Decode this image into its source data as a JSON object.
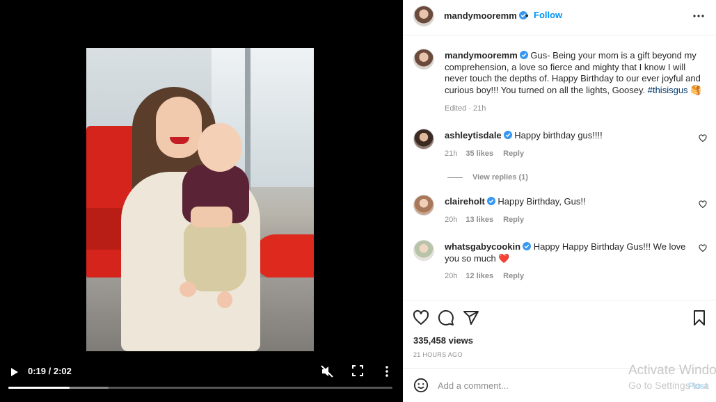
{
  "video": {
    "time": "0:19 / 2:02",
    "progress_played": 0.16,
    "progress_buffered": 0.26
  },
  "header": {
    "username": "mandymooremm",
    "separator": "•",
    "follow_label": "Follow"
  },
  "caption": {
    "username": "mandymooremm",
    "text": "Gus- Being your mom is a gift beyond my comprehension, a love so fierce and mighty that I know I will never touch the depths of. Happy Birthday to our ever joyful and curious boy!!! You turned on all the lights, Goosey.",
    "hashtag": "#thisisgus",
    "emoji": "🥞",
    "meta": "Edited · 21h"
  },
  "comments": [
    {
      "username": "ashleytisdale",
      "verified": true,
      "text": "Happy birthday gus!!!!",
      "time": "21h",
      "likes": "35 likes",
      "reply": "Reply",
      "view_replies": "View replies (1)"
    },
    {
      "username": "claireholt",
      "verified": true,
      "text": "Happy Birthday, Gus!!",
      "time": "20h",
      "likes": "13 likes",
      "reply": "Reply"
    },
    {
      "username": "whatsgabycookin",
      "verified": true,
      "text": "Happy Happy Birthday Gus!!! We love you so much",
      "emoji": "❤️",
      "time": "20h",
      "likes": "12 likes",
      "reply": "Reply"
    }
  ],
  "stats": {
    "views": "335,458 views",
    "posted": "21 HOURS AGO"
  },
  "add_comment": {
    "placeholder": "Add a comment...",
    "post_label": "Post"
  },
  "watermark": {
    "line1": "Activate Windo",
    "line2": "Go to Settings to a"
  },
  "colors": {
    "accent": "#0095f6",
    "verified": "#3897f0",
    "hashtag": "#00376b",
    "muted": "#8e8e8e",
    "heart_red": "#ed4956"
  }
}
